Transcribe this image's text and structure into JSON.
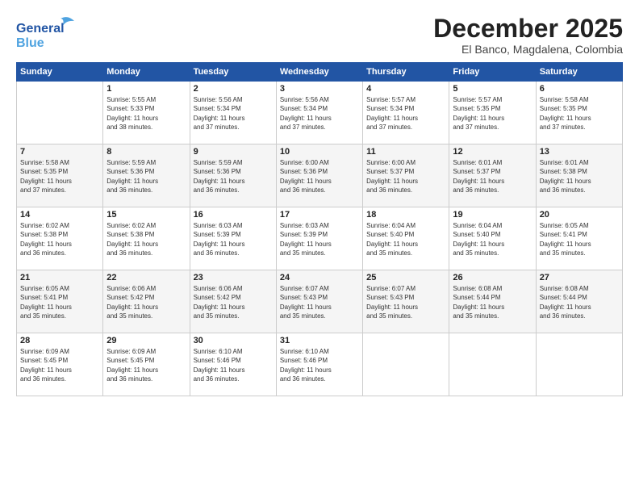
{
  "header": {
    "logo_line1": "General",
    "logo_line2": "Blue",
    "month": "December 2025",
    "location": "El Banco, Magdalena, Colombia"
  },
  "weekdays": [
    "Sunday",
    "Monday",
    "Tuesday",
    "Wednesday",
    "Thursday",
    "Friday",
    "Saturday"
  ],
  "weeks": [
    [
      {
        "day": "",
        "content": ""
      },
      {
        "day": "1",
        "content": "Sunrise: 5:55 AM\nSunset: 5:33 PM\nDaylight: 11 hours\nand 38 minutes."
      },
      {
        "day": "2",
        "content": "Sunrise: 5:56 AM\nSunset: 5:34 PM\nDaylight: 11 hours\nand 37 minutes."
      },
      {
        "day": "3",
        "content": "Sunrise: 5:56 AM\nSunset: 5:34 PM\nDaylight: 11 hours\nand 37 minutes."
      },
      {
        "day": "4",
        "content": "Sunrise: 5:57 AM\nSunset: 5:34 PM\nDaylight: 11 hours\nand 37 minutes."
      },
      {
        "day": "5",
        "content": "Sunrise: 5:57 AM\nSunset: 5:35 PM\nDaylight: 11 hours\nand 37 minutes."
      },
      {
        "day": "6",
        "content": "Sunrise: 5:58 AM\nSunset: 5:35 PM\nDaylight: 11 hours\nand 37 minutes."
      }
    ],
    [
      {
        "day": "7",
        "content": "Sunrise: 5:58 AM\nSunset: 5:35 PM\nDaylight: 11 hours\nand 37 minutes."
      },
      {
        "day": "8",
        "content": "Sunrise: 5:59 AM\nSunset: 5:36 PM\nDaylight: 11 hours\nand 36 minutes."
      },
      {
        "day": "9",
        "content": "Sunrise: 5:59 AM\nSunset: 5:36 PM\nDaylight: 11 hours\nand 36 minutes."
      },
      {
        "day": "10",
        "content": "Sunrise: 6:00 AM\nSunset: 5:36 PM\nDaylight: 11 hours\nand 36 minutes."
      },
      {
        "day": "11",
        "content": "Sunrise: 6:00 AM\nSunset: 5:37 PM\nDaylight: 11 hours\nand 36 minutes."
      },
      {
        "day": "12",
        "content": "Sunrise: 6:01 AM\nSunset: 5:37 PM\nDaylight: 11 hours\nand 36 minutes."
      },
      {
        "day": "13",
        "content": "Sunrise: 6:01 AM\nSunset: 5:38 PM\nDaylight: 11 hours\nand 36 minutes."
      }
    ],
    [
      {
        "day": "14",
        "content": "Sunrise: 6:02 AM\nSunset: 5:38 PM\nDaylight: 11 hours\nand 36 minutes."
      },
      {
        "day": "15",
        "content": "Sunrise: 6:02 AM\nSunset: 5:38 PM\nDaylight: 11 hours\nand 36 minutes."
      },
      {
        "day": "16",
        "content": "Sunrise: 6:03 AM\nSunset: 5:39 PM\nDaylight: 11 hours\nand 36 minutes."
      },
      {
        "day": "17",
        "content": "Sunrise: 6:03 AM\nSunset: 5:39 PM\nDaylight: 11 hours\nand 35 minutes."
      },
      {
        "day": "18",
        "content": "Sunrise: 6:04 AM\nSunset: 5:40 PM\nDaylight: 11 hours\nand 35 minutes."
      },
      {
        "day": "19",
        "content": "Sunrise: 6:04 AM\nSunset: 5:40 PM\nDaylight: 11 hours\nand 35 minutes."
      },
      {
        "day": "20",
        "content": "Sunrise: 6:05 AM\nSunset: 5:41 PM\nDaylight: 11 hours\nand 35 minutes."
      }
    ],
    [
      {
        "day": "21",
        "content": "Sunrise: 6:05 AM\nSunset: 5:41 PM\nDaylight: 11 hours\nand 35 minutes."
      },
      {
        "day": "22",
        "content": "Sunrise: 6:06 AM\nSunset: 5:42 PM\nDaylight: 11 hours\nand 35 minutes."
      },
      {
        "day": "23",
        "content": "Sunrise: 6:06 AM\nSunset: 5:42 PM\nDaylight: 11 hours\nand 35 minutes."
      },
      {
        "day": "24",
        "content": "Sunrise: 6:07 AM\nSunset: 5:43 PM\nDaylight: 11 hours\nand 35 minutes."
      },
      {
        "day": "25",
        "content": "Sunrise: 6:07 AM\nSunset: 5:43 PM\nDaylight: 11 hours\nand 35 minutes."
      },
      {
        "day": "26",
        "content": "Sunrise: 6:08 AM\nSunset: 5:44 PM\nDaylight: 11 hours\nand 35 minutes."
      },
      {
        "day": "27",
        "content": "Sunrise: 6:08 AM\nSunset: 5:44 PM\nDaylight: 11 hours\nand 36 minutes."
      }
    ],
    [
      {
        "day": "28",
        "content": "Sunrise: 6:09 AM\nSunset: 5:45 PM\nDaylight: 11 hours\nand 36 minutes."
      },
      {
        "day": "29",
        "content": "Sunrise: 6:09 AM\nSunset: 5:45 PM\nDaylight: 11 hours\nand 36 minutes."
      },
      {
        "day": "30",
        "content": "Sunrise: 6:10 AM\nSunset: 5:46 PM\nDaylight: 11 hours\nand 36 minutes."
      },
      {
        "day": "31",
        "content": "Sunrise: 6:10 AM\nSunset: 5:46 PM\nDaylight: 11 hours\nand 36 minutes."
      },
      {
        "day": "",
        "content": ""
      },
      {
        "day": "",
        "content": ""
      },
      {
        "day": "",
        "content": ""
      }
    ]
  ]
}
